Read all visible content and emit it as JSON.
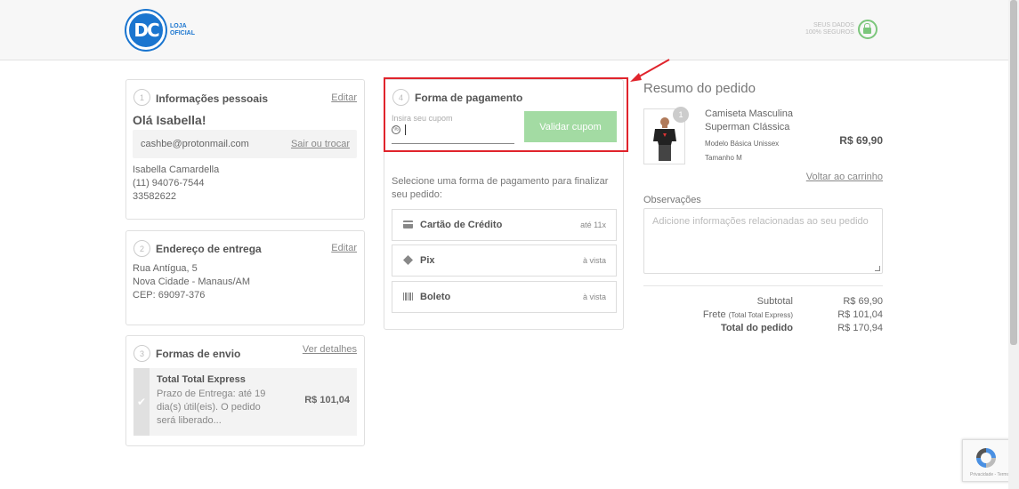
{
  "header": {
    "logo_mark": "DC",
    "logo_line1": "LOJA",
    "logo_line2": "OFICIAL",
    "secure_line1": "SEUS DADOS",
    "secure_line2": "100% SEGUROS"
  },
  "personal": {
    "step": "1",
    "title": "Informações pessoais",
    "edit": "Editar",
    "greeting": "Olá Isabella!",
    "email": "cashbe@protonmail.com",
    "switch_link": "Sair ou trocar",
    "name": "Isabella Camardella",
    "phone": "(11) 94076-7544",
    "doc": "33582622"
  },
  "address": {
    "step": "2",
    "title": "Endereço de entrega",
    "edit": "Editar",
    "line1": "Rua Antígua, 5",
    "line2": "Nova Cidade - Manaus/AM",
    "line3": "CEP: 69097-376"
  },
  "shipping": {
    "step": "3",
    "title": "Formas de envio",
    "details_link": "Ver detalhes",
    "option_name": "Total Total Express",
    "option_desc": "Prazo de Entrega: até 19 dia(s) útil(eis). O pedido será liberado...",
    "option_price": "R$ 101,04"
  },
  "payment": {
    "step": "4",
    "title": "Forma de pagamento",
    "coupon_label": "Insira seu cupom",
    "coupon_button": "Validar cupom",
    "instruction": "Selecione uma forma de pagamento para finalizar seu pedido:",
    "options": [
      {
        "name": "Cartão de Crédito",
        "info": "até 11x",
        "icon": "credit-card-icon"
      },
      {
        "name": "Pix",
        "info": "à vista",
        "icon": "pix-icon"
      },
      {
        "name": "Boleto",
        "info": "à vista",
        "icon": "barcode-icon"
      }
    ]
  },
  "summary": {
    "title": "Resumo do pedido",
    "qty": "1",
    "product_name": "Camiseta Masculina Superman Clássica",
    "product_model": "Modelo Básica Unissex",
    "product_size": "Tamanho M",
    "product_price": "R$ 69,90",
    "back_link": "Voltar ao carrinho",
    "obs_label": "Observações",
    "obs_placeholder": "Adicione informações relacionadas ao seu pedido",
    "subtotal_label": "Subtotal",
    "subtotal_value": "R$ 69,90",
    "freight_label": "Frete",
    "freight_detail": "(Total Total Express)",
    "freight_value": "R$ 101,04",
    "total_label": "Total do pedido",
    "total_value": "R$ 170,94"
  },
  "recaptcha": {
    "text": "Privacidade - Termos"
  },
  "colors": {
    "accent_blue": "#1a75cf",
    "highlight_red": "#e0242c",
    "button_green": "#a3dba3"
  }
}
